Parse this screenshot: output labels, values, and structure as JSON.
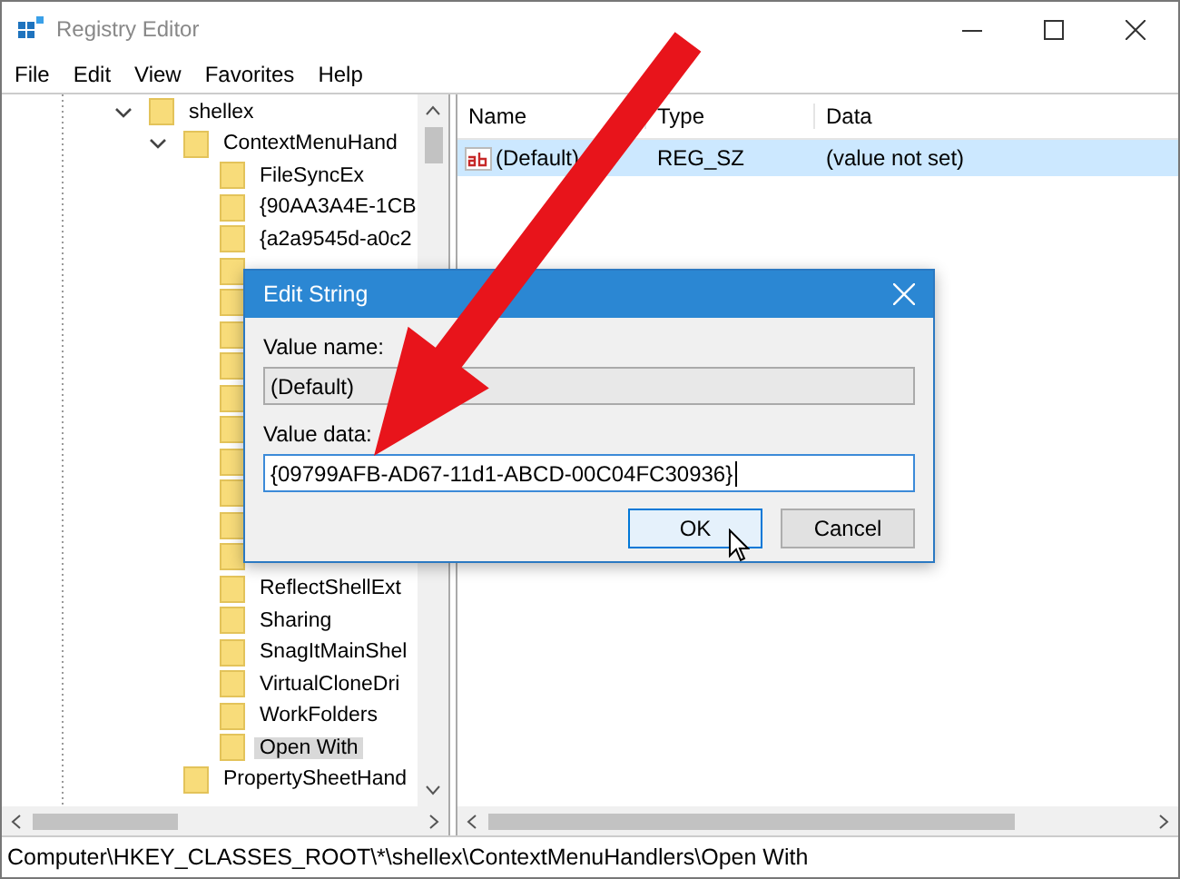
{
  "window": {
    "title": "Registry Editor"
  },
  "menu": [
    "File",
    "Edit",
    "View",
    "Favorites",
    "Help"
  ],
  "tree": [
    {
      "label": "shellex",
      "expanded": true,
      "selected": false,
      "children": [
        {
          "label": "ContextMenuHand",
          "expanded": true,
          "selected": false,
          "children": [
            {
              "label": "FileSyncEx",
              "selected": false
            },
            {
              "label": "{90AA3A4E-1CB",
              "selected": false
            },
            {
              "label": "{a2a9545d-a0c2",
              "selected": false
            },
            {
              "label": "ReflectShellExt",
              "selected": false
            },
            {
              "label": "Sharing",
              "selected": false
            },
            {
              "label": "SnagItMainShel",
              "selected": false
            },
            {
              "label": "VirtualCloneDri",
              "selected": false
            },
            {
              "label": "WorkFolders",
              "selected": false
            },
            {
              "label": "Open With",
              "selected": true
            }
          ]
        },
        {
          "label": "PropertySheetHand",
          "expanded": false,
          "selected": false
        }
      ]
    }
  ],
  "list": {
    "columns": [
      "Name",
      "Type",
      "Data"
    ],
    "rows": [
      {
        "name": "(Default)",
        "type": "REG_SZ",
        "data": "(value not set)",
        "selected": true
      }
    ]
  },
  "dialog": {
    "title": "Edit String",
    "fields": [
      {
        "label": "Value name:",
        "value": "(Default)",
        "kind": "readonly"
      },
      {
        "label": "Value data:",
        "value": "{09799AFB-AD67-11d1-ABCD-00C04FC30936}",
        "kind": "edit"
      }
    ],
    "buttons": [
      {
        "label": "OK",
        "default": true
      },
      {
        "label": "Cancel",
        "default": false
      }
    ]
  },
  "status_bar": "Computer\\HKEY_CLASSES_ROOT\\*\\shellex\\ContextMenuHandlers\\Open With"
}
